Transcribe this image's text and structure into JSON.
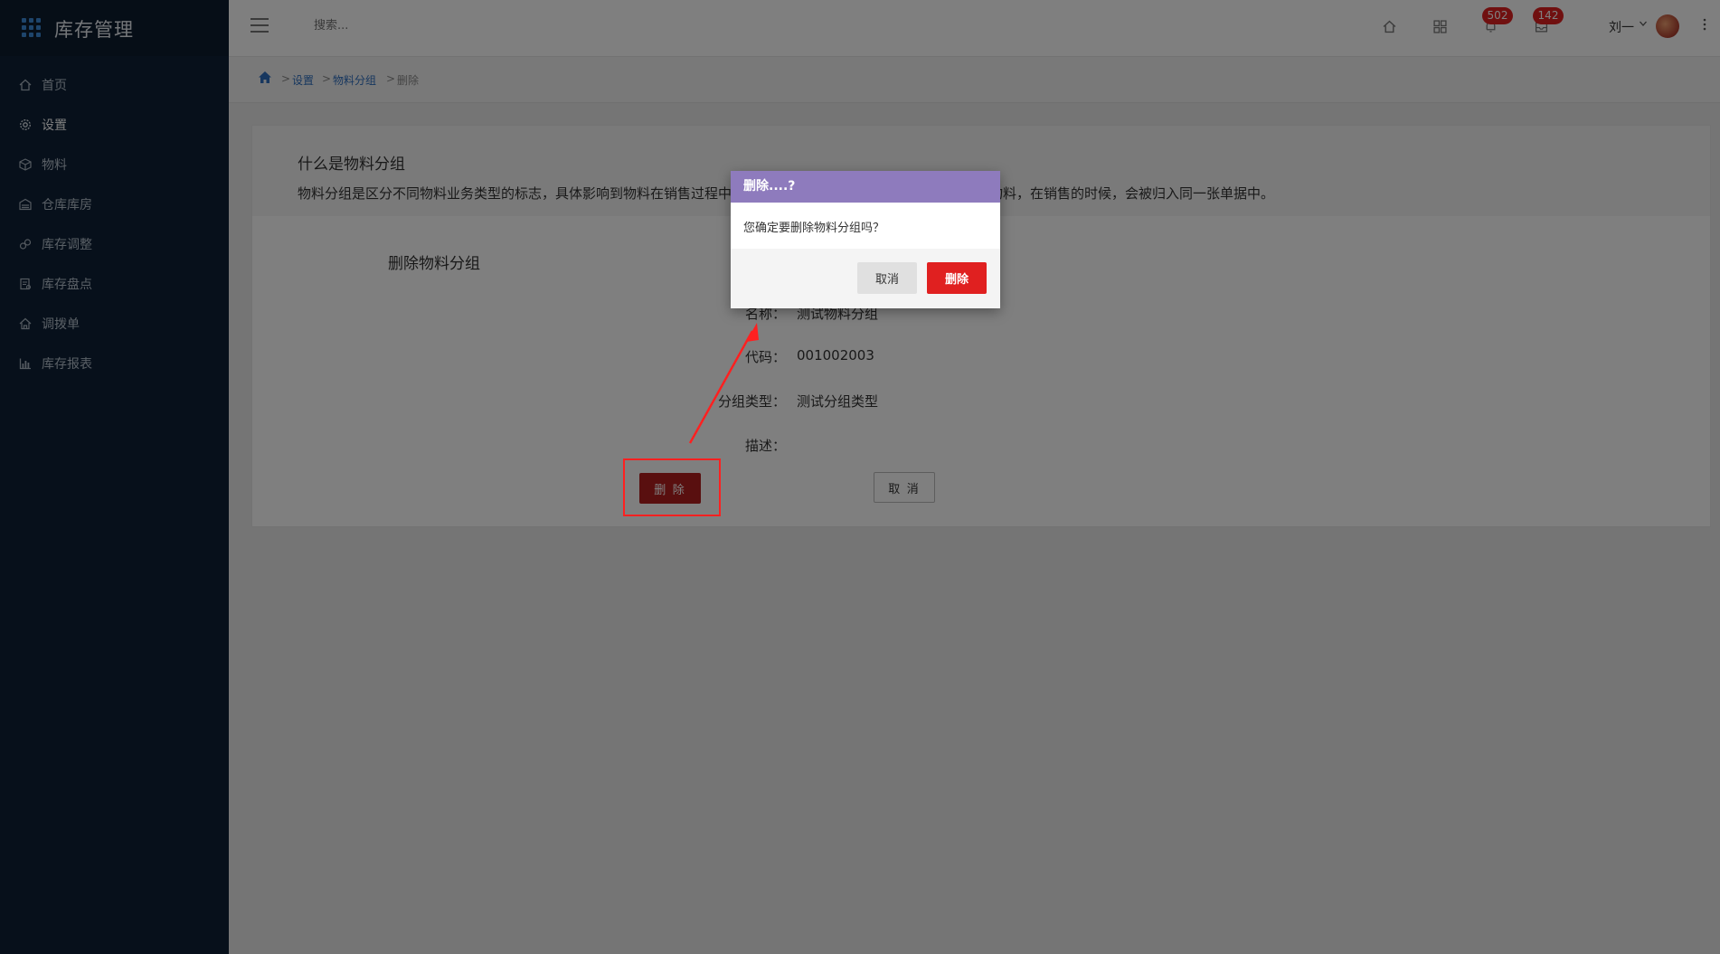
{
  "app": {
    "title": "库存管理"
  },
  "sidebar": {
    "items": [
      {
        "label": "首页",
        "icon": "home-icon"
      },
      {
        "label": "设置",
        "icon": "gear-icon"
      },
      {
        "label": "物料",
        "icon": "cube-icon"
      },
      {
        "label": "仓库库房",
        "icon": "warehouse-icon"
      },
      {
        "label": "库存调整",
        "icon": "adjust-icon"
      },
      {
        "label": "库存盘点",
        "icon": "inventory-icon"
      },
      {
        "label": "调拨单",
        "icon": "transfer-icon"
      },
      {
        "label": "库存报表",
        "icon": "chart-icon"
      }
    ]
  },
  "header": {
    "search_placeholder": "搜索...",
    "notifications_badge": "502",
    "messages_badge": "142",
    "user_name": "刘一"
  },
  "breadcrumb": {
    "items": [
      "设置",
      "物料分组",
      "删除"
    ]
  },
  "info": {
    "title": "什么是物料分组",
    "description": "物料分组是区分不同物料业务类型的标志，具体影响到物料在销售过程中，是否能被合并到同一张单据中；同分组的物料，在销售的时候，会被归入同一张单据中。"
  },
  "form": {
    "section_title": "删除物料分组",
    "fields": [
      {
        "label": "名称：",
        "value": "测试物料分组"
      },
      {
        "label": "代码：",
        "value": "001002003"
      },
      {
        "label": "分组类型：",
        "value": "测试分组类型"
      },
      {
        "label": "描述：",
        "value": ""
      }
    ],
    "delete_label": "删 除",
    "cancel_label": "取 消"
  },
  "modal": {
    "title": "删除....?",
    "message": "您确定要删除物料分组吗？",
    "cancel_label": "取消",
    "delete_label": "删除"
  },
  "colors": {
    "sidebar_bg": "#0f2137",
    "modal_header": "#8e7bbd",
    "danger": "#e02020",
    "link": "#2f6fbf"
  }
}
